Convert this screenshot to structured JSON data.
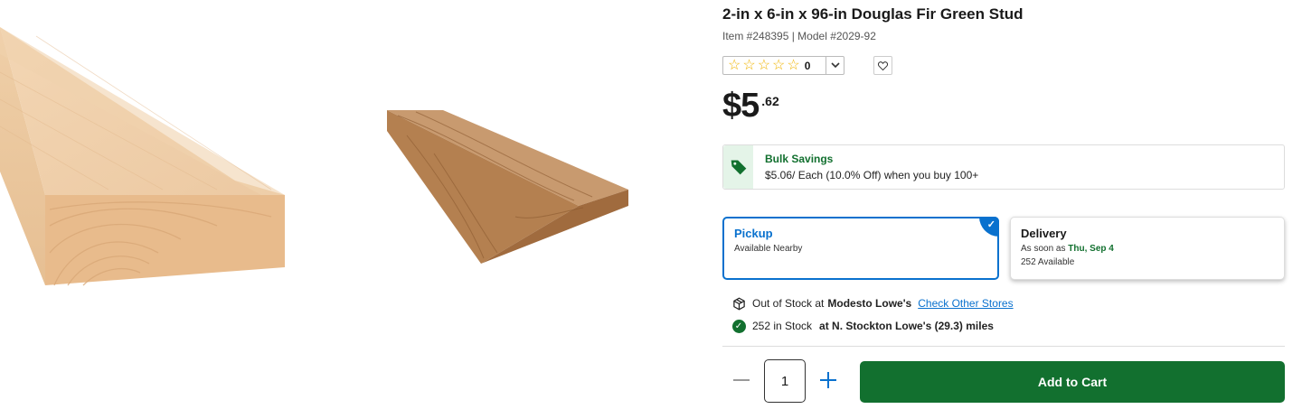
{
  "product": {
    "title": "2-in x 6-in x 96-in Douglas Fir Green Stud",
    "item_line": "Item #248395 | Model #2029-92",
    "rating_count": "0",
    "price_main": "$5",
    "price_cents": ".62",
    "images": [
      "lumber-board-end-view",
      "lumber-board-angled-view"
    ]
  },
  "bulk": {
    "title": "Bulk Savings",
    "desc": "$5.06/ Each (10.0% Off) when you buy 100+",
    "icon": "tag-icon"
  },
  "fulfillment": {
    "pickup": {
      "title": "Pickup",
      "sub": "Available Nearby",
      "selected": true
    },
    "delivery": {
      "title": "Delivery",
      "sub_prefix": "As soon as",
      "date": "Thu, Sep 4",
      "available": "252 Available"
    }
  },
  "stock": {
    "row1_prefix": "Out of Stock at",
    "row1_store": "Modesto Lowe's",
    "row1_link": "Check Other Stores",
    "row2_prefix": "252 in Stock",
    "row2_store": "at N. Stockton Lowe's (29.3) miles"
  },
  "cart": {
    "quantity": "1",
    "add_label": "Add to Cart"
  },
  "colors": {
    "brand_blue": "#0971ce",
    "brand_green": "#12702f",
    "star": "#f0b400"
  }
}
